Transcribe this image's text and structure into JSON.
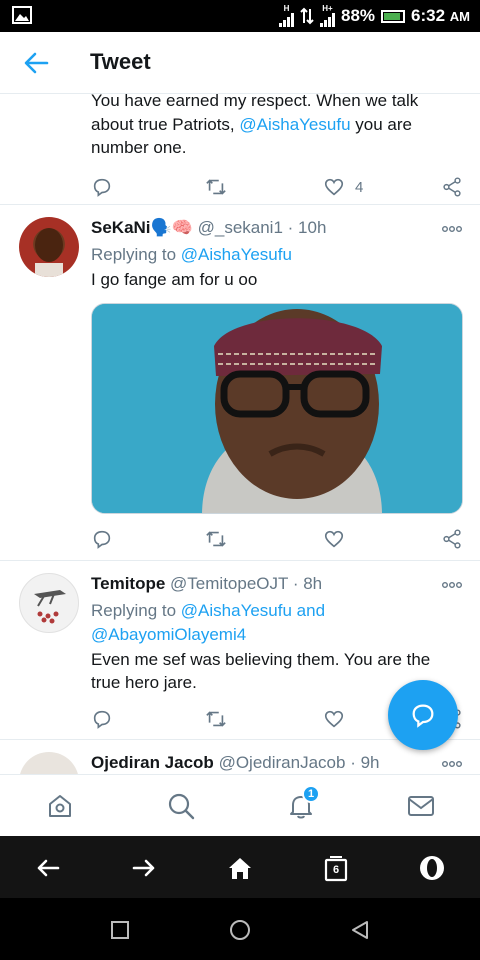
{
  "status_bar": {
    "battery": "88%",
    "time": "6:32",
    "ampm": "AM",
    "net1": "H",
    "net2": "H+"
  },
  "header": {
    "title": "Tweet"
  },
  "tweets": [
    {
      "lines": [
        "You have earned my respect. When we talk",
        "about true Patriots,",
        "@AishaYesufu",
        "you are",
        "number one."
      ],
      "like_count": "4"
    },
    {
      "name": "SeKaNi",
      "emoji": "🗣️🧠",
      "handle": "@_sekani1",
      "time": "· 10h",
      "replying_label": "Replying to",
      "replying_to": "@AishaYesufu",
      "text": "I go fange am for u oo"
    },
    {
      "name": "Temitope",
      "handle": "@TemitopeOJT",
      "time": "· 8h",
      "replying_label": "Replying to",
      "replying_to": "@AishaYesufu and",
      "replying_to2": "@AbayomiOlayemi4",
      "text1": "Even me sef was believing them. You are the",
      "text2": "true hero jare."
    },
    {
      "name": "Ojediran Jacob",
      "handle": "@OjediranJacob",
      "time": "· 9h"
    }
  ],
  "tabbar": {
    "notifications_badge": "1"
  },
  "browser": {
    "tab_count": "6"
  },
  "colors": {
    "accent": "#1da1f2",
    "text": "#14171a",
    "muted": "#657786"
  }
}
